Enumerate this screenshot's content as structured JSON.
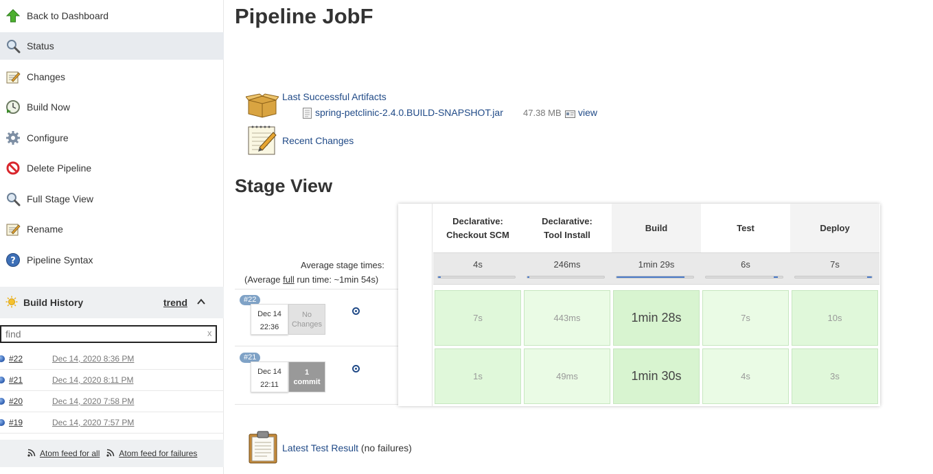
{
  "sidebar": {
    "tasks": [
      {
        "label": "Back to Dashboard",
        "icon": "up-arrow-icon"
      },
      {
        "label": "Status",
        "icon": "magnifier-icon"
      },
      {
        "label": "Changes",
        "icon": "notepad-icon"
      },
      {
        "label": "Build Now",
        "icon": "clock-play-icon"
      },
      {
        "label": "Configure",
        "icon": "gear-icon"
      },
      {
        "label": "Delete Pipeline",
        "icon": "no-entry-icon"
      },
      {
        "label": "Full Stage View",
        "icon": "magnifier-icon"
      },
      {
        "label": "Rename",
        "icon": "notepad-icon"
      },
      {
        "label": "Pipeline Syntax",
        "icon": "help-icon"
      }
    ],
    "build_history": {
      "title": "Build History",
      "trend": "trend",
      "search_placeholder": "find",
      "search_clear": "x",
      "builds": [
        {
          "number": "#22",
          "date": "Dec 14, 2020 8:36 PM"
        },
        {
          "number": "#21",
          "date": "Dec 14, 2020 8:11 PM"
        },
        {
          "number": "#20",
          "date": "Dec 14, 2020 7:58 PM"
        },
        {
          "number": "#19",
          "date": "Dec 14, 2020 7:57 PM"
        }
      ],
      "feeds": {
        "all": "Atom feed for all",
        "failures": "Atom feed for failures"
      }
    }
  },
  "main": {
    "title": "Pipeline JobF",
    "artifacts": {
      "label": "Last Successful Artifacts",
      "file": "spring-petclinic-2.4.0.BUILD-SNAPSHOT.jar",
      "size": "47.38 MB",
      "view": "view"
    },
    "recent_changes": "Recent Changes",
    "stage_view": {
      "title": "Stage View",
      "avg_stage_label": "Average stage times:",
      "avg_run_prefix": "(Average ",
      "avg_run_link": "full",
      "avg_run_suffix": " run time: ~1min 54s)",
      "stages": [
        {
          "line1": "Declarative:",
          "line2": "Checkout SCM",
          "avg": "4s",
          "bar_start": 0.0,
          "bar_fraction": 0.04
        },
        {
          "line1": "Declarative:",
          "line2": "Tool Install",
          "avg": "246ms",
          "bar_start": 0.0,
          "bar_fraction": 0.01
        },
        {
          "line1": "Build",
          "line2": "",
          "avg": "1min 29s",
          "bar_start": 0.0,
          "bar_fraction": 0.88
        },
        {
          "line1": "Test",
          "line2": "",
          "avg": "6s",
          "bar_start": 0.88,
          "bar_fraction": 0.06
        },
        {
          "line1": "Deploy",
          "line2": "",
          "avg": "7s",
          "bar_start": 0.94,
          "bar_fraction": 0.06
        }
      ],
      "runs": [
        {
          "badge": "#22",
          "date": "Dec 14",
          "time": "22:36",
          "changes_line1": "No",
          "changes_line2": "Changes",
          "cells": [
            "7s",
            "443ms",
            "1min 28s",
            "7s",
            "10s"
          ]
        },
        {
          "badge": "#21",
          "date": "Dec 14",
          "time": "22:11",
          "changes_line1": "1",
          "changes_line2": "commit",
          "cells": [
            "1s",
            "49ms",
            "1min 30s",
            "4s",
            "3s"
          ]
        }
      ]
    },
    "test_result": {
      "link": "Latest Test Result",
      "note": "(no failures)"
    }
  }
}
